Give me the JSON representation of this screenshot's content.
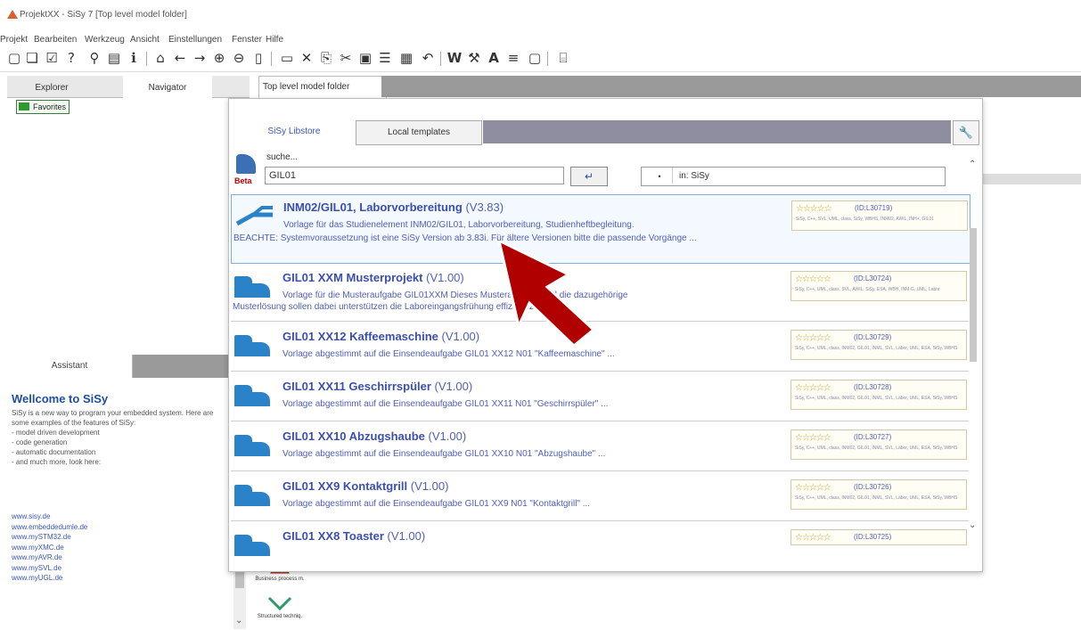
{
  "window": {
    "title": "ProjektXX - SiSy 7 [Top level model folder]"
  },
  "menu": [
    "Projekt",
    "Bearbeiten",
    "Werkzeug",
    "Ansicht",
    "Einstellungen",
    "Fenster",
    "Hilfe"
  ],
  "left_panel": {
    "tabs": [
      "Explorer",
      "Navigator"
    ],
    "tree": {
      "favorites": "Favorites"
    }
  },
  "assistant": {
    "tab": "Assistant",
    "title": "Wellcome to SiSy",
    "intro": "SiSy is a new way to program your embedded system. Here are some examples of the features of SiSy:",
    "features": [
      "- model driven development",
      "- code generation",
      "- automatic documentation",
      "- and much more, look here:"
    ],
    "links": [
      "www.sisy.de",
      "www.embeddedumle.de",
      "www.mySTM32.de",
      "www.myXMC.de",
      "www.myAVR.de",
      "www.mySVL.de",
      "www.myUGL.de"
    ]
  },
  "palette": {
    "items": [
      "Business process m.",
      "Structured techniq."
    ]
  },
  "document_tab": "Top level model folder",
  "dialog": {
    "tabs": {
      "libstore": "SiSy Libstore",
      "local": "Local templates"
    },
    "search": {
      "label": "suche...",
      "value": "GIL01",
      "beta": "Beta",
      "enter": "↵",
      "scope_dot": "•",
      "scope": "in: SiSy"
    },
    "results": [
      {
        "name": "INM02/GIL01, Laborvorbereitung",
        "version": "(V3.83)",
        "desc": "Vorlage für das Studienelement INM02/GIL01, Laborvorbereitung, Studienheftbegleitung.",
        "desc2": "BEACHTE: Systemvoraussetzung ist eine SiSy Version ab 3.83i. Für ältere Versionen bitte die passende Vorgänge ...",
        "stars": "☆☆☆☆☆",
        "id": "(ID:L30719)",
        "tags": "SiSy, C++, SVL, UML, class, SiSy, WBHS, INM02, AWIL, INH+, GIL01"
      },
      {
        "name": "GIL01 XXM Musterprojekt",
        "version": "(V1.00)",
        "desc": "Vorlage für die Musteraufgabe GIL01XXM Dieses Musteraufgabe und die dazugehörige",
        "desc2": "Musterlösung sollen dabei unterstützen die Laboreingangsfrühung effizient zu lösen ...",
        "stars": "☆☆☆☆☆",
        "id": "(ID:L30724)",
        "tags": "SiSy, C++, UML, class, SVL, AWIL, SiSy, ESA, WBH, INM-G, UML, Labor"
      },
      {
        "name": "GIL01 XX12 Kaffeemaschine",
        "version": "(V1.00)",
        "desc": "Vorlage abgestimmt auf die Einsendeaufgabe GIL01 XX12 N01 \"Kaffeemaschine\" ...",
        "desc2": "",
        "stars": "☆☆☆☆☆",
        "id": "(ID:L30729)",
        "tags": "SiSy, C++, UML, class, INM02, GIL01, INML, SVL, Labor, UML, ESA, SiSy, WBHS"
      },
      {
        "name": "GIL01 XX11 Geschirrspüler",
        "version": "(V1.00)",
        "desc": "Vorlage abgestimmt auf die Einsendeaufgabe GIL01 XX11 N01 \"Geschirrspüler\" ...",
        "desc2": "",
        "stars": "☆☆☆☆☆",
        "id": "(ID:L30728)",
        "tags": "SiSy, C++, UML, class, INM02, GIL01, INML, SVL, Labor, UML, ESA, SiSy, WBHS"
      },
      {
        "name": "GIL01 XX10 Abzugshaube",
        "version": "(V1.00)",
        "desc": "Vorlage abgestimmt auf die Einsendeaufgabe GIL01 XX10 N01 \"Abzugshaube\" ...",
        "desc2": "",
        "stars": "☆☆☆☆☆",
        "id": "(ID:L30727)",
        "tags": "SiSy, C++, UML, class, INM02, GIL01, INML, SVL, Labor, UML, ESA, SiSy, WBHS"
      },
      {
        "name": "GIL01 XX9 Kontaktgrill",
        "version": "(V1.00)",
        "desc": "Vorlage abgestimmt auf die Einsendeaufgabe GIL01 XX9 N01 \"Kontaktgrill\" ...",
        "desc2": "",
        "stars": "☆☆☆☆☆",
        "id": "(ID:L30726)",
        "tags": "SiSy, C++, UML, class, INM02, GIL01, INML, SVL, Labor, UML, ESA, SiSy, WBHS"
      },
      {
        "name": "GIL01 XX8 Toaster",
        "version": "(V1.00)",
        "desc": "",
        "desc2": "",
        "stars": "☆☆☆☆☆",
        "id": "(ID:L30725)",
        "tags": ""
      }
    ]
  },
  "colors": {
    "accent": "#3a4fb0",
    "pointer": "#b00000",
    "tab_fill": "#8f8ea0"
  }
}
